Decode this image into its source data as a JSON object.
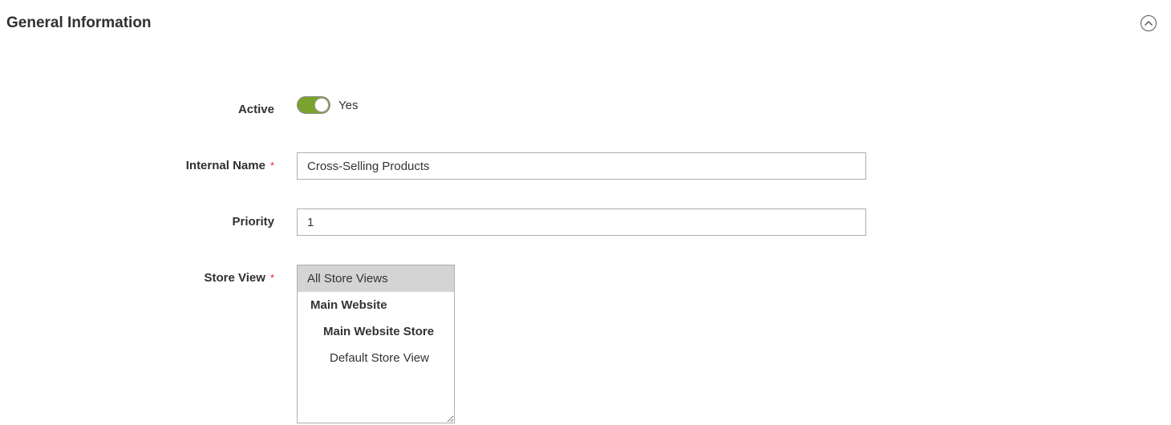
{
  "section": {
    "title": "General Information"
  },
  "form": {
    "active": {
      "label": "Active",
      "value_label": "Yes"
    },
    "internal_name": {
      "label": "Internal Name",
      "value": "Cross-Selling Products"
    },
    "priority": {
      "label": "Priority",
      "value": "1"
    },
    "store_view": {
      "label": "Store View",
      "options": {
        "all": "All Store Views",
        "website": "Main Website",
        "store": "Main Website Store",
        "view": "Default Store View"
      }
    }
  }
}
